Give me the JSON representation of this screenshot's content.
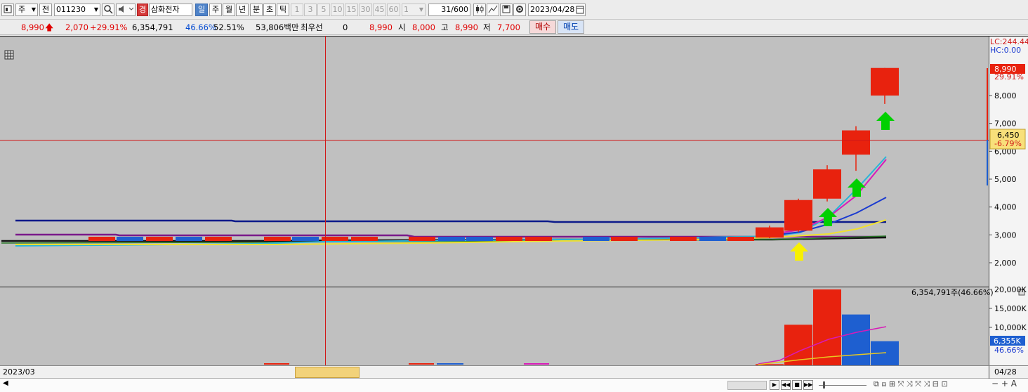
{
  "toolbar": {
    "period_selector": "주",
    "prev_label": "전",
    "stock_code": "011230",
    "warning_badge": "경",
    "stock_name": "삼화전자",
    "period_tabs": [
      "일",
      "주",
      "월",
      "년",
      "분",
      "초",
      "틱"
    ],
    "active_period": "일",
    "interval_buttons": [
      "1",
      "3",
      "5",
      "10",
      "15",
      "30",
      "45",
      "60"
    ],
    "count_value": "1",
    "view_count": "31",
    "view_total": "/600",
    "date": "2023/04/28",
    "icons": [
      "chart-type-icon",
      "magnifier-icon",
      "sound-icon",
      "candle-icon",
      "crosshair-icon",
      "save-icon",
      "gear-icon",
      "calendar-icon"
    ]
  },
  "quote": {
    "price": "8,990",
    "change": "2,070",
    "change_rate": "+29.91%",
    "volume": "6,354,791",
    "volume_ratio": "46.66%",
    "turnover": "52.51%",
    "amount": "53,806백만",
    "best_bid_label": "최우선",
    "best_bid_qty": "0",
    "best_bid_price": "8,990",
    "open_label": "시",
    "open": "8,000",
    "high_label": "고",
    "high": "8,990",
    "low_label": "저",
    "low": "7,700",
    "buy_label": "매수",
    "sell_label": "매도"
  },
  "chart": {
    "lc_label": "LC:244.44",
    "hc_label": "HC:0.00",
    "price_ticks": [
      "8,000",
      "7,000",
      "6,000",
      "5,000",
      "4,000",
      "3,000",
      "2,000"
    ],
    "last_price_tag": "8,990",
    "last_rate_tag": "29.91%",
    "cursor_price_tag": "6,450",
    "cursor_rate_tag": "-6.79%",
    "volume_caption": "6,354,791주(46.66%)",
    "volume_ticks": [
      "20,000K",
      "15,000K",
      "10,000K"
    ],
    "volume_tag": "6,355K",
    "volume_rate_tag": "46.66%",
    "start_date": "2023/03",
    "end_date": "04/28",
    "colors": {
      "up": "#e8220e",
      "down": "#1e5fd0",
      "background": "#c0c0c0",
      "crosshair": "#d01818"
    }
  },
  "chart_data": [
    {
      "type": "candlestick",
      "title": "",
      "ylim": [
        1500,
        9400
      ],
      "candles": [
        {
          "open": 2920,
          "high": 2990,
          "low": 2900,
          "close": 2950,
          "dir": "up"
        },
        {
          "open": 2980,
          "high": 3010,
          "low": 2940,
          "close": 2960,
          "dir": "down"
        },
        {
          "open": 2900,
          "high": 3100,
          "low": 2870,
          "close": 3000,
          "dir": "up"
        },
        {
          "open": 3000,
          "high": 3020,
          "low": 2900,
          "close": 2930,
          "dir": "down"
        },
        {
          "open": 2900,
          "high": 3330,
          "low": 2880,
          "close": 3270,
          "dir": "up"
        },
        {
          "open": 3150,
          "high": 4300,
          "low": 3100,
          "close": 4250,
          "dir": "up"
        },
        {
          "open": 4300,
          "high": 5500,
          "low": 4200,
          "close": 5350,
          "dir": "up"
        },
        {
          "open": 5880,
          "high": 6900,
          "low": 5300,
          "close": 6750,
          "dir": "up"
        },
        {
          "open": 8000,
          "high": 8990,
          "low": 7700,
          "close": 8990,
          "dir": "up"
        }
      ]
    },
    {
      "type": "bar",
      "title": "",
      "ylim": [
        0,
        20000
      ],
      "values": [
        300,
        10700,
        20000,
        13400,
        6355
      ],
      "unit": "K"
    }
  ]
}
